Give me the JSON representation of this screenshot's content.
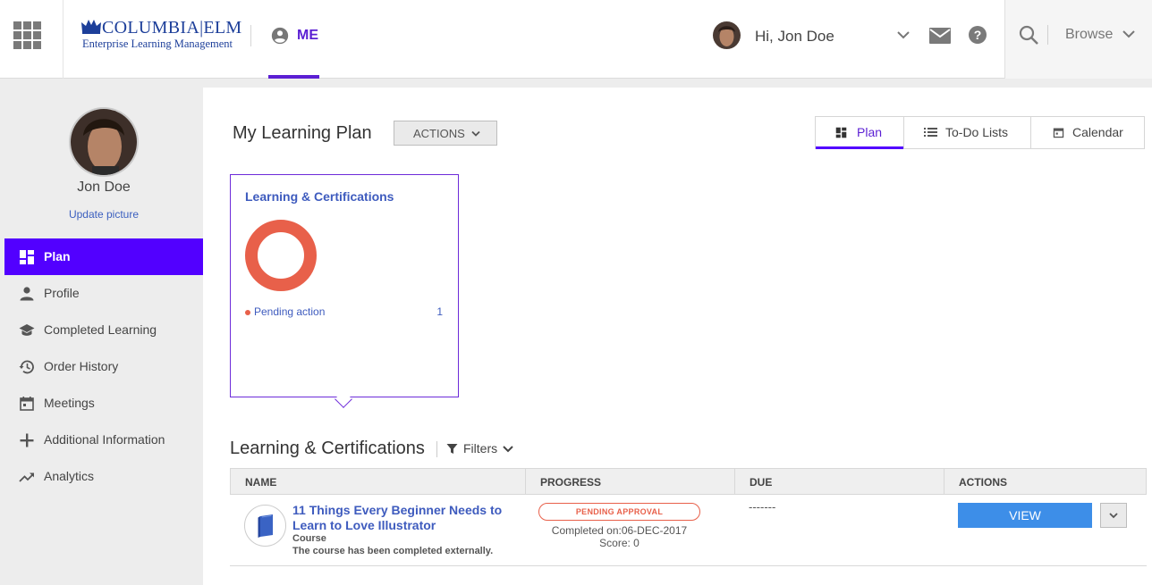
{
  "header": {
    "logo_name": "COLUMBIA|ELM",
    "logo_sub": "Enterprise Learning Management",
    "me_label": "ME",
    "greeting": "Hi, Jon Doe",
    "browse_label": "Browse"
  },
  "sidebar": {
    "user_name": "Jon Doe",
    "update_picture": "Update picture",
    "items": [
      {
        "label": "Plan",
        "icon": "dashboard-icon"
      },
      {
        "label": "Profile",
        "icon": "person-icon"
      },
      {
        "label": "Completed Learning",
        "icon": "graduation-cap-icon"
      },
      {
        "label": "Order History",
        "icon": "history-icon"
      },
      {
        "label": "Meetings",
        "icon": "calendar-icon"
      },
      {
        "label": "Additional Information",
        "icon": "plus-icon"
      },
      {
        "label": "Analytics",
        "icon": "trending-up-icon"
      }
    ],
    "active_index": 0
  },
  "main": {
    "title": "My Learning Plan",
    "actions_label": "ACTIONS",
    "view_tabs": [
      {
        "label": "Plan",
        "icon": "dashboard-icon",
        "active": true
      },
      {
        "label": "To-Do Lists",
        "icon": "list-icon",
        "active": false
      },
      {
        "label": "Calendar",
        "icon": "calendar-icon",
        "active": false
      }
    ],
    "card": {
      "title": "Learning & Certifications",
      "legend_label": "Pending action",
      "legend_count": "1"
    },
    "section_title": "Learning & Certifications",
    "filters_label": "Filters",
    "table": {
      "headers": [
        "NAME",
        "PROGRESS",
        "DUE",
        "ACTIONS"
      ],
      "rows": [
        {
          "title": "11 Things Every Beginner Needs to Learn to Love Illustrator",
          "type": "Course",
          "note": "The course has been completed externally.",
          "status": "PENDING APPROVAL",
          "completed_on": "Completed on:06-DEC-2017",
          "score": "Score: 0",
          "due": "-------",
          "action": "VIEW"
        }
      ]
    }
  },
  "colors": {
    "accent": "#5200ff",
    "link": "#3e5bbe",
    "pending": "#e8604a",
    "view_button": "#3d8ee8"
  }
}
